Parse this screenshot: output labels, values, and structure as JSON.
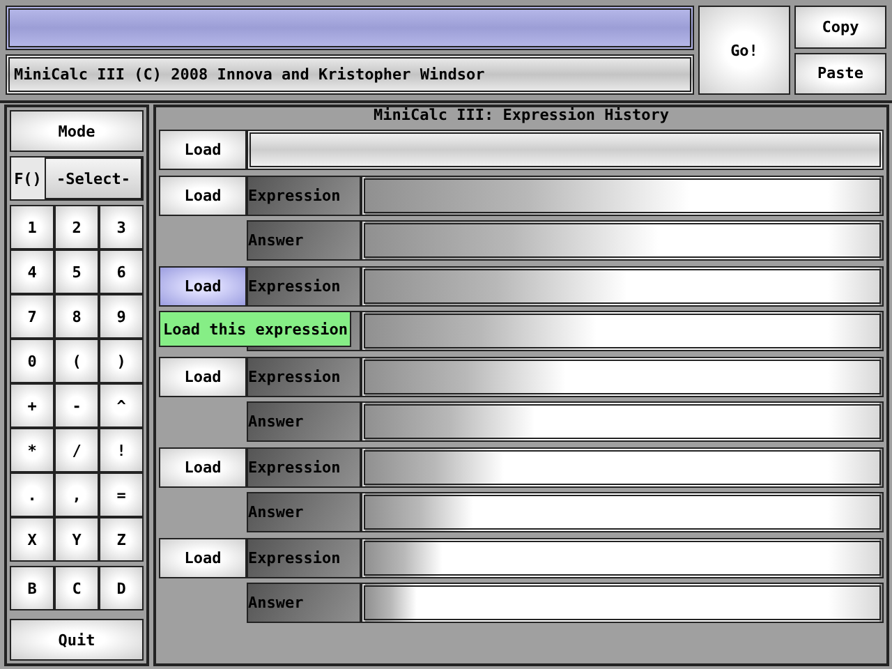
{
  "top": {
    "info_text": "MiniCalc III (C) 2008 Innova and Kristopher Windsor",
    "go": "Go!",
    "copy": "Copy",
    "paste": "Paste"
  },
  "sidebar": {
    "mode": "Mode",
    "f_label": "F()",
    "select": "-Select-",
    "keys": [
      "1",
      "2",
      "3",
      "4",
      "5",
      "6",
      "7",
      "8",
      "9",
      "0",
      "(",
      ")",
      "+",
      "-",
      "^",
      "*",
      "/",
      "!",
      ".",
      ",",
      "=",
      "X",
      "Y",
      "Z"
    ],
    "extra_keys": [
      "B",
      "C",
      "D"
    ],
    "quit": "Quit"
  },
  "history": {
    "title": "MiniCalc III: Expression History",
    "entries": [
      {
        "kind": "single",
        "load": "Load",
        "load_hovered": false
      },
      {
        "kind": "pair",
        "load": "Load",
        "load_hovered": false,
        "expression_label": "Expression",
        "answer_label": "Answer"
      },
      {
        "kind": "pair",
        "load": "Load",
        "load_hovered": true,
        "expression_label": "Expression",
        "tooltip": "Load this expression"
      },
      {
        "kind": "pair",
        "load": "Load",
        "load_hovered": false,
        "expression_label": "Expression",
        "answer_label": "Answer"
      },
      {
        "kind": "pair",
        "load": "Load",
        "load_hovered": false,
        "expression_label": "Expression",
        "answer_label": "Answer"
      },
      {
        "kind": "pair",
        "load": "Load",
        "load_hovered": false,
        "expression_label": "Expression",
        "answer_label": "Answer"
      }
    ]
  }
}
